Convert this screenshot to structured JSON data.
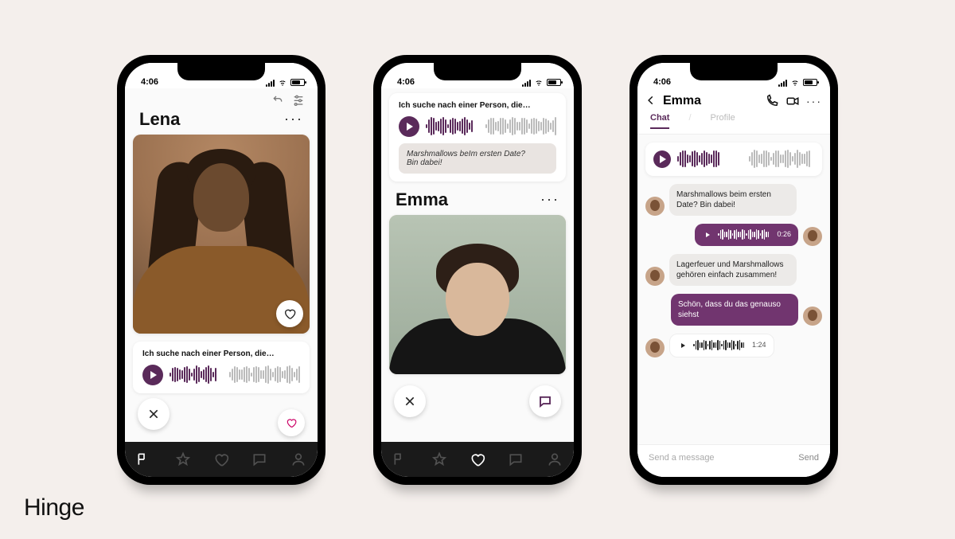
{
  "brand": "Hinge",
  "status": {
    "time": "4:06"
  },
  "screen1": {
    "name": "Lena",
    "more": "···",
    "prompt": "Ich suche nach einer Person, die…"
  },
  "screen2": {
    "prompt": "Ich suche nach einer Person, die…",
    "reply_line1": "Marshmallows beIm ersten Date?",
    "reply_line2": "Bin dabei!",
    "name": "Emma",
    "more": "···"
  },
  "screen3": {
    "name": "Emma",
    "tabs": {
      "chat": "Chat",
      "profile": "Profile"
    },
    "messages": {
      "m1": "Marshmallows beim ersten Date? Bin dabei!",
      "m2_dur": "0:26",
      "m3": "Lagerfeuer und Marshmallows gehören einfach zusammen!",
      "m4": "Schön, dass du das genauso siehst",
      "m5_dur": "1:24"
    },
    "composer": {
      "placeholder": "Send a message",
      "send": "Send"
    }
  },
  "tabs": [
    "discover",
    "standouts",
    "likes",
    "matches",
    "profile"
  ]
}
